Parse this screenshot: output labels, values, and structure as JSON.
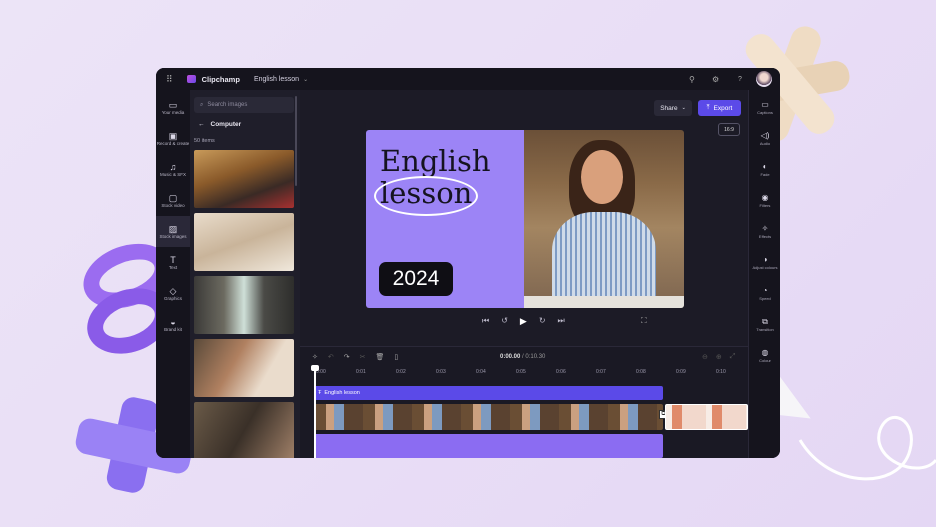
{
  "app": {
    "name": "Clipchamp",
    "project_title": "English lesson"
  },
  "topbar": {
    "icons": [
      "apps-grid-icon",
      "share-link-icon",
      "settings-icon",
      "help-icon",
      "avatar"
    ],
    "help_label": "?"
  },
  "left_rail": [
    {
      "label": "Your media",
      "icon": "folder-icon",
      "glyph": "▭"
    },
    {
      "label": "Record & create",
      "icon": "camera-icon",
      "glyph": "▣"
    },
    {
      "label": "Music & SFX",
      "icon": "music-icon",
      "glyph": "♫"
    },
    {
      "label": "Stock video",
      "icon": "video-icon",
      "glyph": "▢"
    },
    {
      "label": "Stock images",
      "icon": "image-icon",
      "glyph": "▨"
    },
    {
      "label": "Text",
      "icon": "text-icon",
      "glyph": "T"
    },
    {
      "label": "Graphics",
      "icon": "graphics-icon",
      "glyph": "◇"
    },
    {
      "label": "Brand kit",
      "icon": "brand-kit-icon",
      "glyph": "◒"
    }
  ],
  "media_panel": {
    "search_placeholder": "Search images",
    "back_label": "Computer",
    "count": "50 items"
  },
  "preview": {
    "title_line1": "English",
    "title_line2": "lesson",
    "year": "2024",
    "share_label": "Share",
    "export_label": "Export",
    "aspect_ratio": "16:9"
  },
  "right_rail": [
    {
      "label": "Captions",
      "glyph": "▭"
    },
    {
      "label": "Audio",
      "glyph": "◁)"
    },
    {
      "label": "Fade",
      "glyph": "◐"
    },
    {
      "label": "Filters",
      "glyph": "◉"
    },
    {
      "label": "Effects",
      "glyph": "✧"
    },
    {
      "label": "Adjust colours",
      "glyph": "◑"
    },
    {
      "label": "Speed",
      "glyph": "◔"
    },
    {
      "label": "Transition",
      "glyph": "⧉"
    },
    {
      "label": "Colour",
      "glyph": "◍"
    }
  ],
  "timeline": {
    "current_time": "0:00.00",
    "total_time": "0:10.30",
    "separator": " / ",
    "ticks": [
      "0:00",
      "0:01",
      "0:02",
      "0:03",
      "0:04",
      "0:05",
      "0:06",
      "0:07",
      "0:08",
      "0:09",
      "0:10"
    ],
    "text_clip_label": "English lesson"
  },
  "colors": {
    "accent": "#5b4ae8",
    "purple_card": "#9c84f6",
    "audio_clip": "#8b6cf2"
  }
}
